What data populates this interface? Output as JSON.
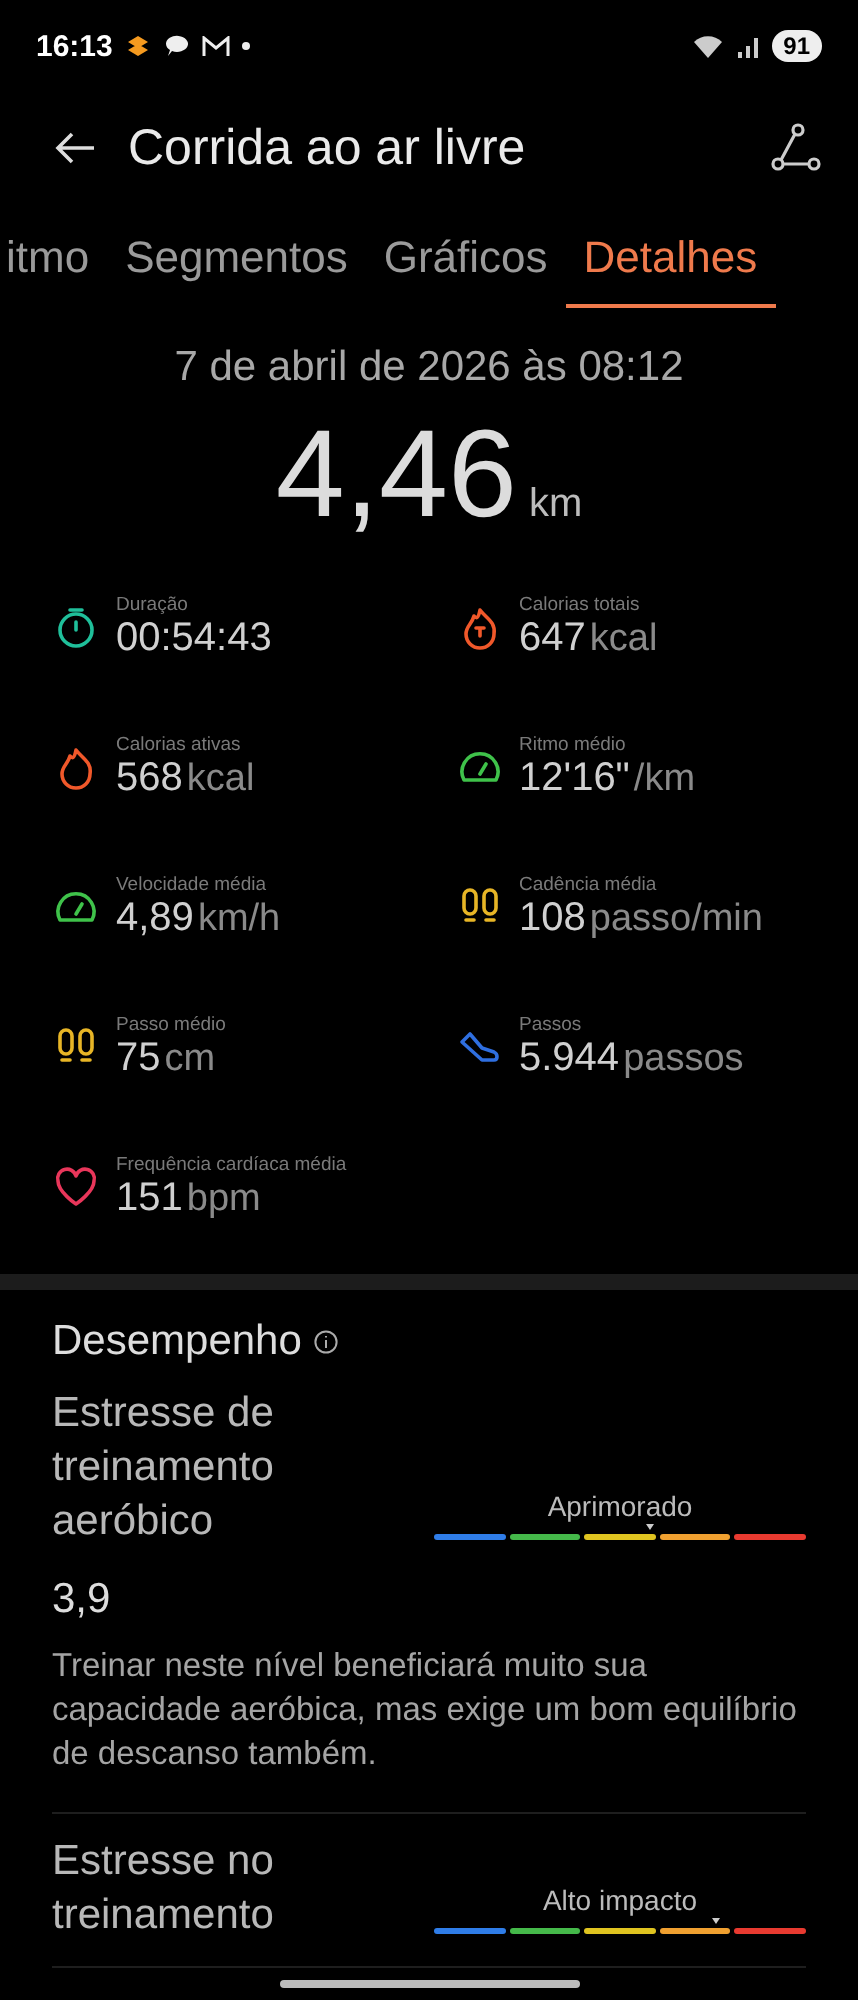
{
  "status_bar": {
    "time": "16:13",
    "battery": "91"
  },
  "header": {
    "title": "Corrida ao ar livre"
  },
  "tabs": [
    {
      "label": "itmo",
      "selected": false
    },
    {
      "label": "Segmentos",
      "selected": false
    },
    {
      "label": "Gráficos",
      "selected": false
    },
    {
      "label": "Detalhes",
      "selected": true
    }
  ],
  "date": "7 de abril de 2026 às 08:12",
  "distance": {
    "value": "4,46",
    "unit": "km"
  },
  "metrics": [
    {
      "kind": "stopwatch",
      "color": "#1fbf9a",
      "label": "Duração",
      "value": "00:54:43"
    },
    {
      "kind": "flamet",
      "color": "#f0582a",
      "label": "Calorias totais",
      "value": "647",
      "unit": "kcal"
    },
    {
      "kind": "flame",
      "color": "#f0582a",
      "label": "Calorias ativas",
      "value": "568",
      "unit": "kcal"
    },
    {
      "kind": "gauge",
      "color": "#3fc24a",
      "label": "Ritmo médio",
      "value": "12'16\"",
      "unit": "/km"
    },
    {
      "kind": "gauge",
      "color": "#3fc24a",
      "label": "Velocidade média",
      "value": "4,89",
      "unit": "km/h"
    },
    {
      "kind": "feet",
      "color": "#e7b526",
      "label": "Cadência média",
      "value": "108",
      "unit": "passo/min"
    },
    {
      "kind": "feet",
      "color": "#e7b526",
      "label": "Passo médio",
      "value": "75",
      "unit": "cm"
    },
    {
      "kind": "shoe",
      "color": "#2f6fe0",
      "label": "Passos",
      "value": "5.944",
      "unit": "passos"
    },
    {
      "kind": "heart",
      "color": "#e8365a",
      "label": "Frequência cardíaca média",
      "value": "151",
      "unit": "bpm"
    }
  ],
  "performance": {
    "title": "Desempenho",
    "items": [
      {
        "title": "Estresse de treinamento aeróbico",
        "level_label": "Aprimorado",
        "level": 0.58,
        "value": "3,9",
        "description": "Treinar neste nível beneficiará muito sua capacidade aeróbica, mas exige um bom equilíbrio de descanso também."
      },
      {
        "title": "Estresse no treinamento",
        "level_label": "Alto impacto",
        "level": 0.76
      }
    ]
  }
}
